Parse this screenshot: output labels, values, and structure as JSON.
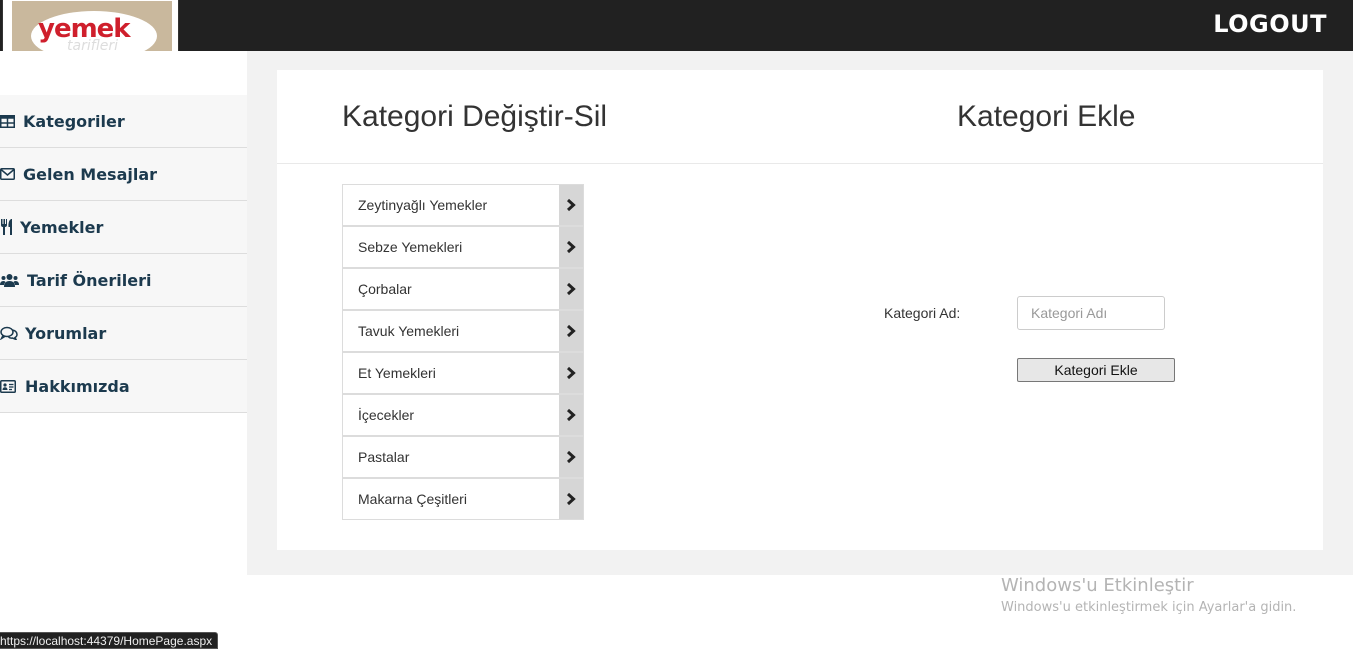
{
  "header": {
    "logo_text": "yemek",
    "logo_subtext": "tarifleri",
    "logout_label": "LOGOUT"
  },
  "sidebar": {
    "items": [
      {
        "label": "Kategoriler",
        "icon": "table-icon"
      },
      {
        "label": "Gelen Mesajlar",
        "icon": "envelope-icon"
      },
      {
        "label": "Yemekler",
        "icon": "utensils-icon"
      },
      {
        "label": "Tarif Önerileri",
        "icon": "users-icon"
      },
      {
        "label": "Yorumlar",
        "icon": "comments-icon"
      },
      {
        "label": "Hakkımızda",
        "icon": "id-card-icon"
      }
    ]
  },
  "main": {
    "left_heading": "Kategori Değiştir-Sil",
    "right_heading": "Kategori Ekle",
    "categories": [
      "Zeytinyağlı Yemekler",
      "Sebze Yemekleri",
      "Çorbalar",
      "Tavuk Yemekleri",
      "Et Yemekleri",
      "İçecekler",
      "Pastalar",
      "Makarna Çeşitleri"
    ],
    "form": {
      "label": "Kategori Ad:",
      "input_placeholder": "Kategori Adı",
      "input_value": "",
      "button_label": "Kategori Ekle"
    }
  },
  "watermark": {
    "title": "Windows'u Etkinleştir",
    "subtitle": "Windows'u etkinleştirmek için Ayarlar'a gidin."
  },
  "status_url": "https://localhost:44379/HomePage.aspx"
}
